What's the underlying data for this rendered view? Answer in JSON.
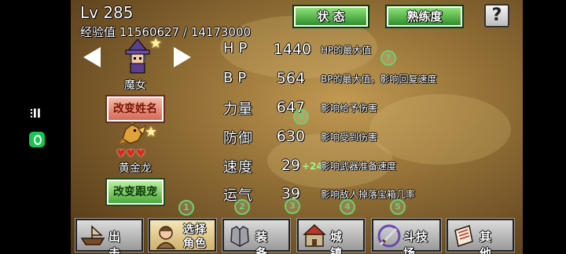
{
  "system": {
    "status_text": "⫶ll"
  },
  "header": {
    "level": "Lv 285",
    "exp": "经验值 11560627 / 14173000"
  },
  "character": {
    "name": "魔女",
    "rename_label": "改变姓名"
  },
  "pet": {
    "name": "黄金龙",
    "hearts": "♥♥♥",
    "change_label": "改变跟宠"
  },
  "tabs": {
    "status": "状 态",
    "proficiency": "熟练度",
    "help": "?"
  },
  "stats": [
    {
      "name": "HP",
      "value": "1440",
      "bonus": "",
      "desc": "HP的最大值"
    },
    {
      "name": "BP",
      "value": "564",
      "bonus": "",
      "desc": "BP的最大值，影响回复速度"
    },
    {
      "name": "力量",
      "value": "647",
      "bonus": "",
      "desc": "影响给予伤害"
    },
    {
      "name": "防御",
      "value": "630",
      "bonus": "",
      "desc": "影响受到伤害"
    },
    {
      "name": "速度",
      "value": "29",
      "bonus": "+24",
      "desc": "影响武器准备速度"
    },
    {
      "name": "运气",
      "value": "39",
      "bonus": "",
      "desc": "影响敌人掉落宝箱几率"
    }
  ],
  "markers": [
    "1",
    "2",
    "3",
    "4",
    "5",
    "6",
    "7"
  ],
  "menu": [
    {
      "label": "出 击"
    },
    {
      "label": "选择",
      "label2": "角色"
    },
    {
      "label": "装 备"
    },
    {
      "label": "城 镇"
    },
    {
      "label": "斗技场"
    },
    {
      "label": "其 他"
    }
  ],
  "colors": {
    "tab_green": "#2f8f2c",
    "button_red": "#d56a58",
    "button_green": "#4da83a",
    "marker_green": "#6dd06d",
    "bonus_green": "#9cf58a"
  }
}
